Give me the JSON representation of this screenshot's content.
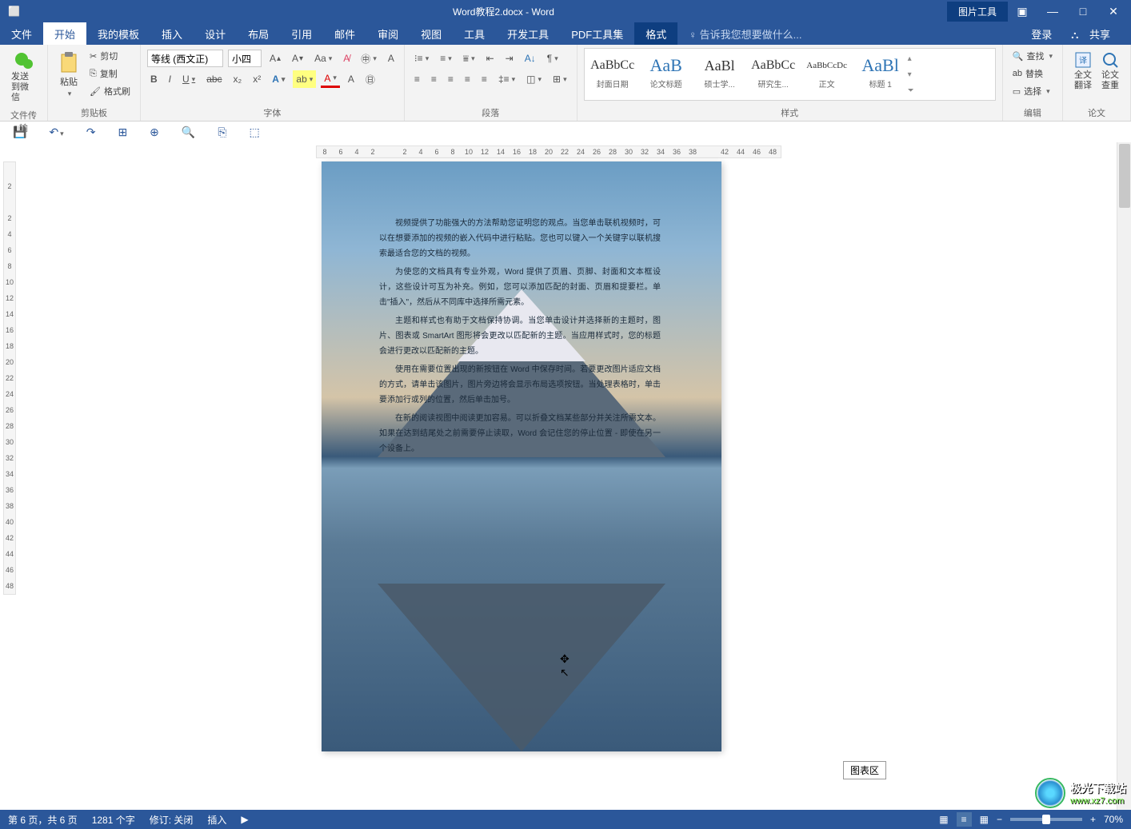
{
  "title": "Word教程2.docx - Word",
  "picture_tools": "图片工具",
  "tabs": {
    "file": "文件",
    "home": "开始",
    "mytpl": "我的模板",
    "insert": "插入",
    "design": "设计",
    "layout": "布局",
    "ref": "引用",
    "mail": "邮件",
    "review": "审阅",
    "view": "视图",
    "tools": "工具",
    "dev": "开发工具",
    "pdf": "PDF工具集",
    "format": "格式",
    "hint": "告诉我您想要做什么...",
    "login": "登录",
    "share": "共享"
  },
  "ribbon": {
    "send_wechat": "发送\n到微信",
    "file_transfer": "文件传输",
    "paste": "粘贴",
    "cut": "剪切",
    "copy": "复制",
    "painter": "格式刷",
    "clipboard": "剪贴板",
    "font_name": "等线 (西文正)",
    "font_size": "小四",
    "font_group": "字体",
    "para_group": "段落",
    "styles": {
      "s1": {
        "prev": "AaBbCc",
        "name": "封面日期"
      },
      "s2": {
        "prev": "AaB",
        "name": "论文标题"
      },
      "s3": {
        "prev": "AaBl",
        "name": "硕士学..."
      },
      "s4": {
        "prev": "AaBbCc",
        "name": "研究生..."
      },
      "s5": {
        "prev": "AaBbCcDc",
        "name": "正文"
      },
      "s6": {
        "prev": "AaBl",
        "name": "标题 1"
      },
      "group": "样式"
    },
    "find": "查找",
    "replace": "替换",
    "select": "选择",
    "edit_group": "编辑",
    "translate": "全文\n翻译",
    "check": "论文\n查重",
    "thesis_group": "论文"
  },
  "hruler": [
    "8",
    "6",
    "4",
    "2",
    "",
    "2",
    "4",
    "6",
    "8",
    "10",
    "12",
    "14",
    "16",
    "18",
    "20",
    "22",
    "24",
    "26",
    "28",
    "30",
    "32",
    "34",
    "36",
    "38",
    "",
    "42",
    "44",
    "46",
    "48"
  ],
  "vruler": [
    "",
    "2",
    "",
    "2",
    "4",
    "6",
    "8",
    "10",
    "12",
    "14",
    "16",
    "18",
    "20",
    "22",
    "24",
    "26",
    "28",
    "30",
    "32",
    "34",
    "36",
    "38",
    "40",
    "42",
    "44",
    "46",
    "48"
  ],
  "doc": {
    "p1": "视频提供了功能强大的方法帮助您证明您的观点。当您单击联机视频时，可以在想要添加的视频的嵌入代码中进行粘贴。您也可以键入一个关键字以联机搜索最适合您的文档的视频。",
    "p2": "为使您的文档具有专业外观，Word 提供了页眉、页脚、封面和文本框设计，这些设计可互为补充。例如，您可以添加匹配的封面、页眉和提要栏。单击\"插入\"，然后从不同库中选择所需元素。",
    "p3": "主题和样式也有助于文档保持协调。当您单击设计并选择新的主题时，图片、图表或 SmartArt 图形将会更改以匹配新的主题。当应用样式时，您的标题会进行更改以匹配新的主题。",
    "p4": "使用在需要位置出现的新按钮在 Word 中保存时间。若要更改图片适应文档的方式，请单击该图片，图片旁边将会显示布局选项按钮。当处理表格时，单击要添加行或列的位置，然后单击加号。",
    "p5": "在新的阅读视图中阅读更加容易。可以折叠文档某些部分并关注所需文本。如果在达到结尾处之前需要停止读取，Word 会记住您的停止位置 - 即使在另一个设备上。"
  },
  "tooltip": "图表区",
  "status": {
    "page": "第 6 页，共 6 页",
    "words": "1281 个字",
    "track": "修订: 关闭",
    "insert": "插入",
    "zoom": "70%"
  },
  "watermark": {
    "name": "极光下载站",
    "url": "www.xz7.com"
  }
}
